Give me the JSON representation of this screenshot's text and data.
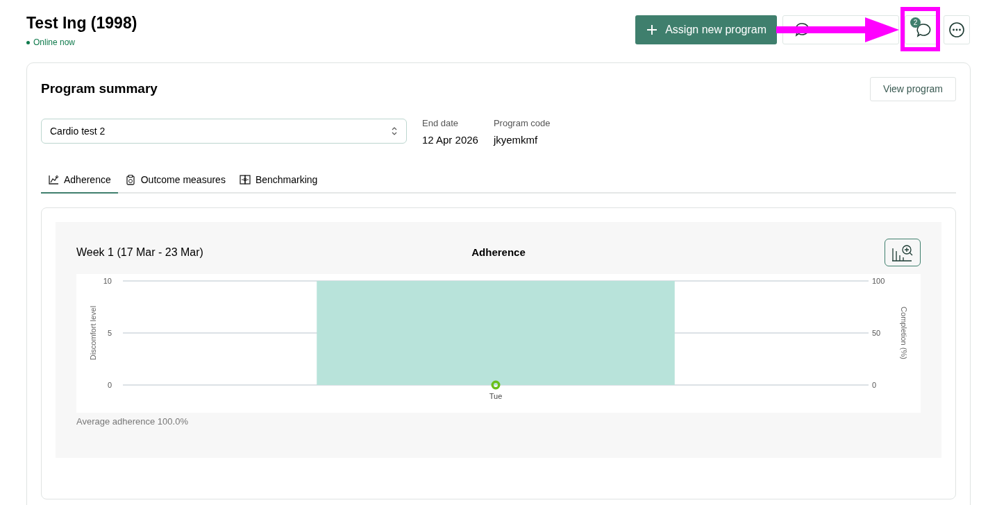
{
  "patient": {
    "name": "Test Ing (1998)",
    "status": "Online now",
    "online": true
  },
  "actions": {
    "assign": "Assign new program",
    "messages_badge": "2"
  },
  "summary": {
    "title": "Program summary",
    "view_button": "View program",
    "program_select": "Cardio test 2",
    "fields": [
      {
        "label": "End date",
        "value": "12 Apr 2026"
      },
      {
        "label": "Program code",
        "value": "jkyemkmf"
      }
    ]
  },
  "tabs": [
    {
      "label": "Adherence",
      "kind": "chart",
      "selected": true
    },
    {
      "label": "Outcome measures",
      "kind": "clipboard",
      "selected": false
    },
    {
      "label": "Benchmarking",
      "kind": "compare",
      "selected": false
    }
  ],
  "panel": {
    "week": "Week 1 (17 Mar - 23 Mar)",
    "title": "Adherence",
    "chart_data": {
      "type": "bar",
      "ylabel": "Completion (%)",
      "categories": [
        "Tue"
      ],
      "ylim": [
        0,
        100
      ],
      "yticks": [
        0,
        50,
        100
      ],
      "series": [
        {
          "color": "#b8e3da",
          "values": [
            100
          ]
        },
        {
          "color": "#6bbf1a",
          "values": [
            0
          ]
        }
      ]
    },
    "secondary_axis": {
      "label": "Discomfort level",
      "ticks": [
        "10",
        "5",
        "0"
      ]
    },
    "average": "Average adherence 100.0%"
  }
}
